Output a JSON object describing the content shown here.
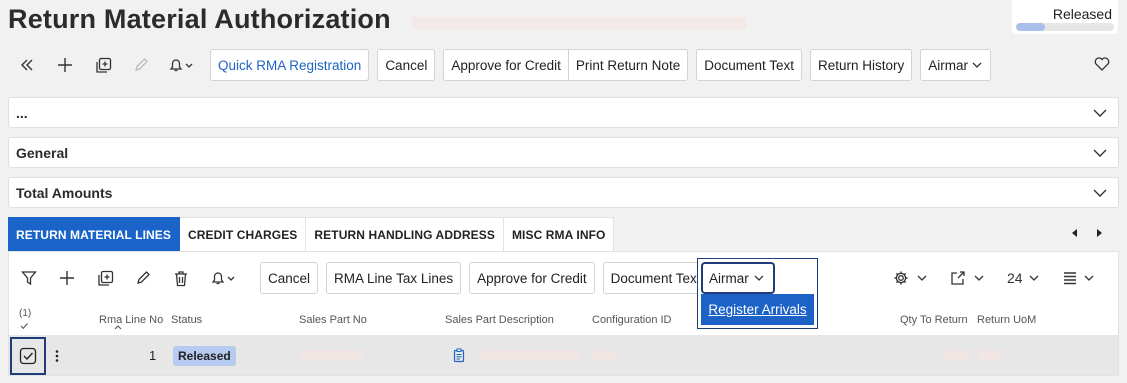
{
  "header": {
    "title": "Return Material Authorization",
    "status": "Released",
    "progress_fraction": 0.3
  },
  "toolbar": {
    "icons": [
      "collapse-left-icon",
      "plus-icon",
      "duplicate-icon",
      "edit-icon",
      "bell-icon",
      "chevron-down-icon"
    ],
    "buttons": {
      "quick_rma": "Quick RMA Registration",
      "cancel": "Cancel",
      "approve_credit": "Approve for Credit",
      "print_return_note": "Print Return Note",
      "document_text": "Document Text",
      "return_history": "Return History",
      "airmar": "Airmar"
    }
  },
  "panels": {
    "more": "...",
    "general": "General",
    "total_amounts": "Total Amounts"
  },
  "tabs": [
    {
      "label": "RETURN MATERIAL LINES",
      "active": true
    },
    {
      "label": "CREDIT CHARGES",
      "active": false
    },
    {
      "label": "RETURN HANDLING ADDRESS",
      "active": false
    },
    {
      "label": "MISC RMA INFO",
      "active": false
    }
  ],
  "grid_toolbar": {
    "buttons": {
      "cancel": "Cancel",
      "rma_line_tax": "RMA Line Tax Lines",
      "approve_credit": "Approve for Credit",
      "document_text": "Document Text"
    },
    "page_size": "24"
  },
  "dropdown": {
    "label": "Airmar",
    "items": [
      "Register Arrivals"
    ]
  },
  "grid": {
    "selected_count": "(1)",
    "columns": {
      "rma_line_no": "Rma Line No",
      "status": "Status",
      "sales_part_no": "Sales Part No",
      "sales_part_description": "Sales Part Description",
      "configuration_id": "Configuration ID",
      "qty_to_return": "Qty To Return",
      "return_uom": "Return UoM"
    },
    "rows": [
      {
        "rma_line_no": "1",
        "status": "Released"
      }
    ]
  },
  "colors": {
    "accent": "#1a63c8",
    "badge": "#b7caf0",
    "focus": "#1f3d7a"
  }
}
